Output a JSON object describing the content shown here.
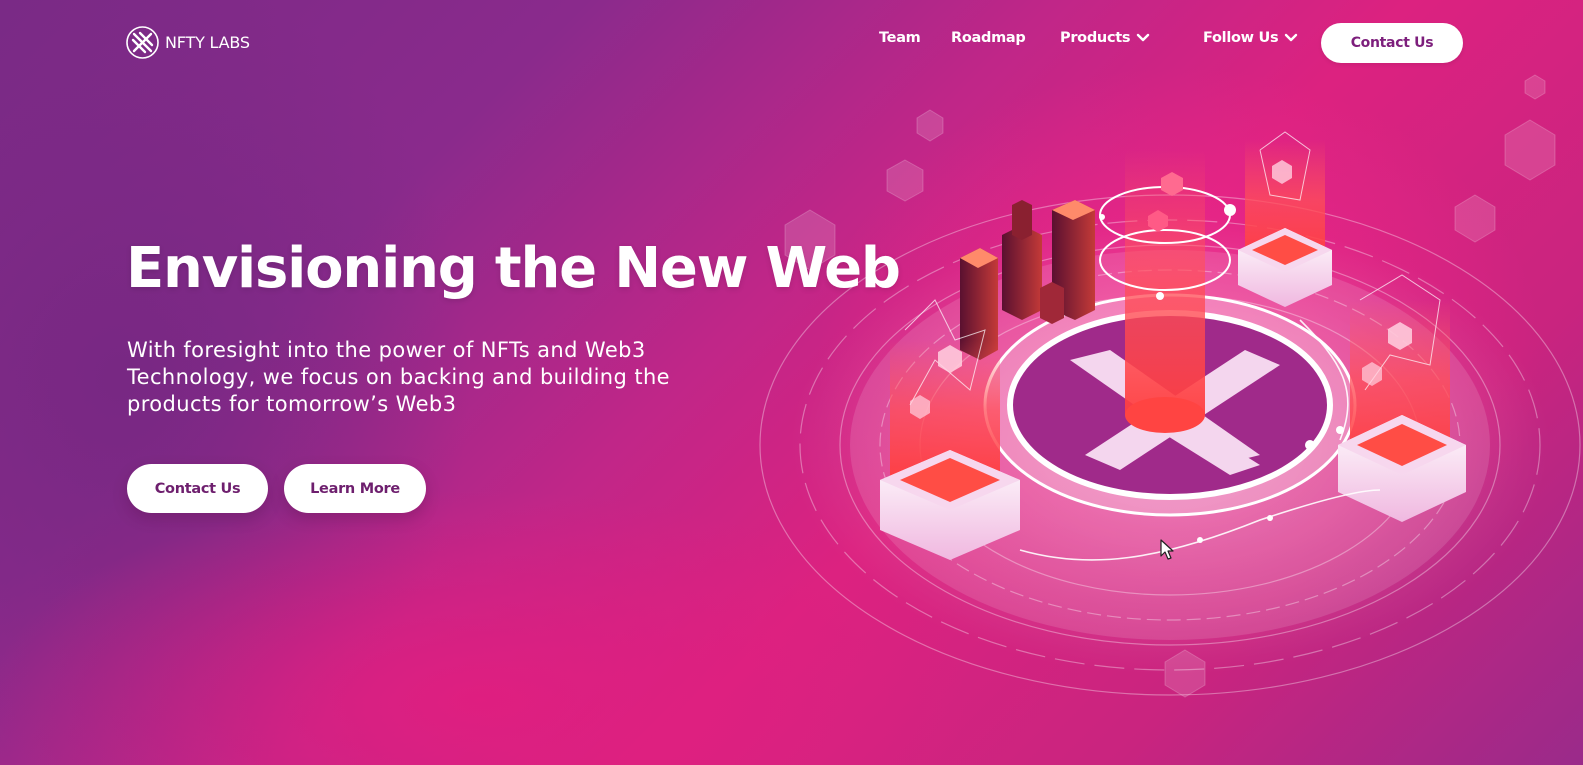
{
  "brand": {
    "name": "NFTY LABS"
  },
  "nav": {
    "items": [
      {
        "label": "Team",
        "has_dropdown": false
      },
      {
        "label": "Roadmap",
        "has_dropdown": false
      },
      {
        "label": "Products",
        "has_dropdown": true
      },
      {
        "label": "Follow Us",
        "has_dropdown": true
      }
    ],
    "cta_label": "Contact Us"
  },
  "hero": {
    "title": "Envisioning the New Web",
    "subtitle": "With foresight into the power of NFTs and Web3 Technology, we focus on backing and building the products for tomorrow’s Web3",
    "primary_button": "Contact Us",
    "secondary_button": "Learn More"
  },
  "colors": {
    "accent_purple": "#7a2a86",
    "accent_pink": "#e0237f",
    "button_text": "#7d1f7c",
    "button_bg": "#ffffff"
  },
  "icons": {
    "logo": "nfty-labs-logo-icon",
    "dropdown": "chevron-down-icon",
    "cursor": "mouse-cursor-icon"
  }
}
